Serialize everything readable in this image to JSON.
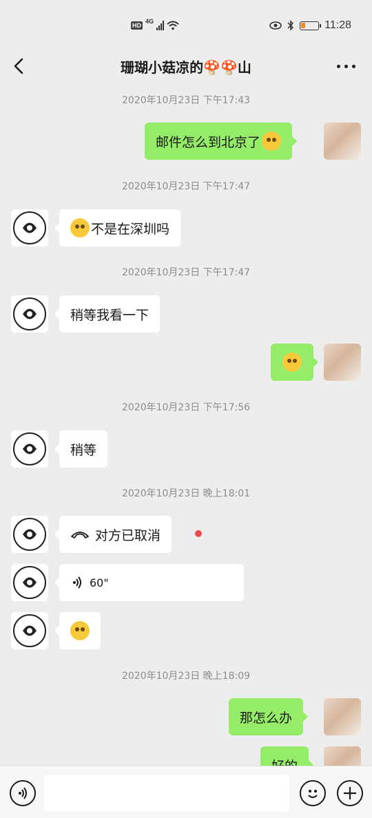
{
  "status_bar": {
    "hd": "HD",
    "network": "4G",
    "time": "11:28"
  },
  "header": {
    "title": "珊瑚小菇凉的🍄🍄山"
  },
  "messages": [
    {
      "timestamp": "2020年10月23日 下午17:43"
    },
    {
      "text": "邮件怎么到北京了"
    },
    {
      "timestamp": "2020年10月23日 下午17:47"
    },
    {
      "text": "不是在深圳吗"
    },
    {
      "timestamp": "2020年10月23日 下午17:47"
    },
    {
      "text": "稍等我看一下"
    },
    {
      "emoji": "laughing-tears-emoji"
    },
    {
      "timestamp": "2020年10月23日 下午17:56"
    },
    {
      "text": "稍等"
    },
    {
      "timestamp": "2020年10月23日 晚上18:01"
    },
    {
      "text": "对方已取消"
    },
    {
      "text": "60\""
    },
    {
      "emoji": "sweat-emoji"
    },
    {
      "timestamp": "2020年10月23日 晚上18:09"
    },
    {
      "text": "那怎么办"
    },
    {
      "text": "好的"
    }
  ],
  "colors": {
    "bubble_me": "#95ec69",
    "bubble_them": "#ffffff",
    "background": "#ededed",
    "unread_dot": "#f04a4a"
  }
}
